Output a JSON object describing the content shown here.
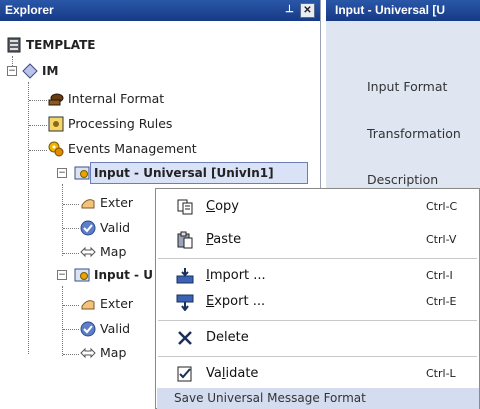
{
  "explorer": {
    "title": "Explorer",
    "pin_glyph": "⊥",
    "close_glyph": "✕",
    "tree": {
      "root": "TEMPLATE",
      "im": "IM",
      "internal_format": "Internal Format",
      "processing_rules": "Processing Rules",
      "events_management": "Events Management",
      "input_universal": "Input - Universal [UnivIn1]",
      "child_extern": "Exter",
      "child_valid": "Valid",
      "child_map": "Map",
      "input_second": "Input - U",
      "child2_extern": "Exter",
      "child2_valid": "Valid",
      "child2_map": "Map"
    }
  },
  "editor": {
    "title": "Input - Universal [U",
    "labels": {
      "input_format": "Input Format",
      "transformation": "Transformation",
      "description": "Description"
    }
  },
  "context_menu": {
    "items": [
      {
        "label_pre": "",
        "label_ul": "C",
        "label_post": "opy",
        "shortcut": "Ctrl-C",
        "icon": "copy-icon"
      },
      {
        "label_pre": "",
        "label_ul": "P",
        "label_post": "aste",
        "shortcut": "Ctrl-V",
        "icon": "paste-icon"
      },
      {
        "label_pre": "",
        "label_ul": "I",
        "label_post": "mport ...",
        "shortcut": "Ctrl-I",
        "icon": "import-icon"
      },
      {
        "label_pre": "",
        "label_ul": "E",
        "label_post": "xport ...",
        "shortcut": "Ctrl-E",
        "icon": "export-icon"
      },
      {
        "label_pre": "Delete",
        "label_ul": "",
        "label_post": "",
        "shortcut": "",
        "icon": "delete-icon"
      },
      {
        "label_pre": "Va",
        "label_ul": "l",
        "label_post": "idate",
        "shortcut": "Ctrl-L",
        "icon": "validate-icon"
      }
    ],
    "highlighted_item": "Save Universal Message Format"
  },
  "colors": {
    "title_bar": "#1e4796",
    "selection": "#d9e2f6",
    "menu_highlight": "#d4dcef",
    "panel_bg": "#dfe6f1"
  }
}
